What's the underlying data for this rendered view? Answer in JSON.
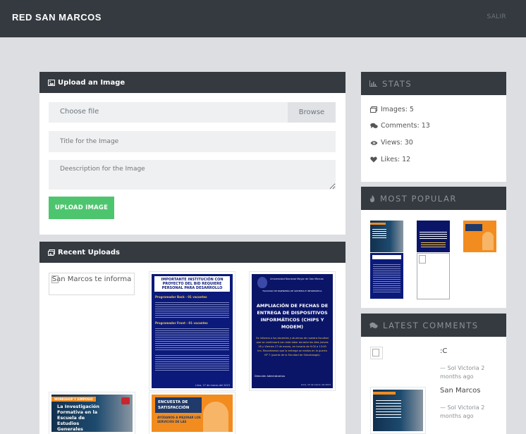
{
  "navbar": {
    "brand": "RED SAN MARCOS",
    "link": "SALIR"
  },
  "upload": {
    "title": "Upload an Image",
    "file_placeholder": "Choose file",
    "browse_label": "Browse",
    "title_placeholder": "Title for the Image",
    "description_placeholder": "Deescription for the Image",
    "button_label": "UPLOAD IMAGE"
  },
  "recent": {
    "title": "Recent Uploads",
    "broken_alt": "San Marcos te informa",
    "poster1": {
      "headline": "IMPORTANTE INSTITUCIÓN CON PROYECTO DEL BID REQUIERE PERSONAL PARA DESARROLLO",
      "sub1": "Programador Back - 01 vacantes",
      "sub2": "Programador Front - 01 vacantes",
      "footer": "Lima, 27 de marzo del 2023"
    },
    "poster2": {
      "org": "Universidad Nacional Mayor de San Marcos",
      "faculty": "FACULTAD DE INGENIERÍA DE SISTEMAS E INFORMÁTICA",
      "headline": "AMPLIACIÓN DE FECHAS DE ENTREGA DE DISPOSITIVOS INFORMÁTICOS (CHIPS Y MODEM)",
      "body": "Se informa a los docentes y alumnos de nuestra facultad que se continuará con esta labor durante los días Jueves 16 y Viernes 17 de marzo, en horario de 9:00 a 13:00 hrs. Recordamos que la entrega se realiza en la puerta Nº 7 (puerta de la Facultad de Odontología)",
      "signature": "Dirección Administrativa",
      "footer": "Lima, 15 de marzo del 2023"
    },
    "poster3": {
      "tag": "WORKSHOP Y SIMPOSIO",
      "headline": "La Investigación Formativa en la Escuela de Estudios Generales"
    },
    "poster4": {
      "headline": "ENCUESTA DE SATISFACCIÓN",
      "sub": "AYÚDANOS A MEJORAR LOS SERVICIOS DE LAS"
    }
  },
  "stats": {
    "title": "STATS",
    "images": "Images: 5",
    "comments": "Comments: 13",
    "views": "Views: 30",
    "likes": "Likes: 12"
  },
  "popular": {
    "title": "MOST POPULAR"
  },
  "latest": {
    "title": "LATEST COMMENTS",
    "items": [
      {
        "text": ":C",
        "meta_line1": "— Sol Victoria 2",
        "meta_line2": "months ago"
      },
      {
        "text": "San Marcos",
        "meta_line1": "— Sol Victoria 2",
        "meta_line2": "months ago"
      }
    ]
  },
  "colors": {
    "navbar": "#343a40",
    "button": "#4dc56e",
    "poster_navy": "#0b1a7a",
    "poster_orange": "#f28c1e"
  }
}
